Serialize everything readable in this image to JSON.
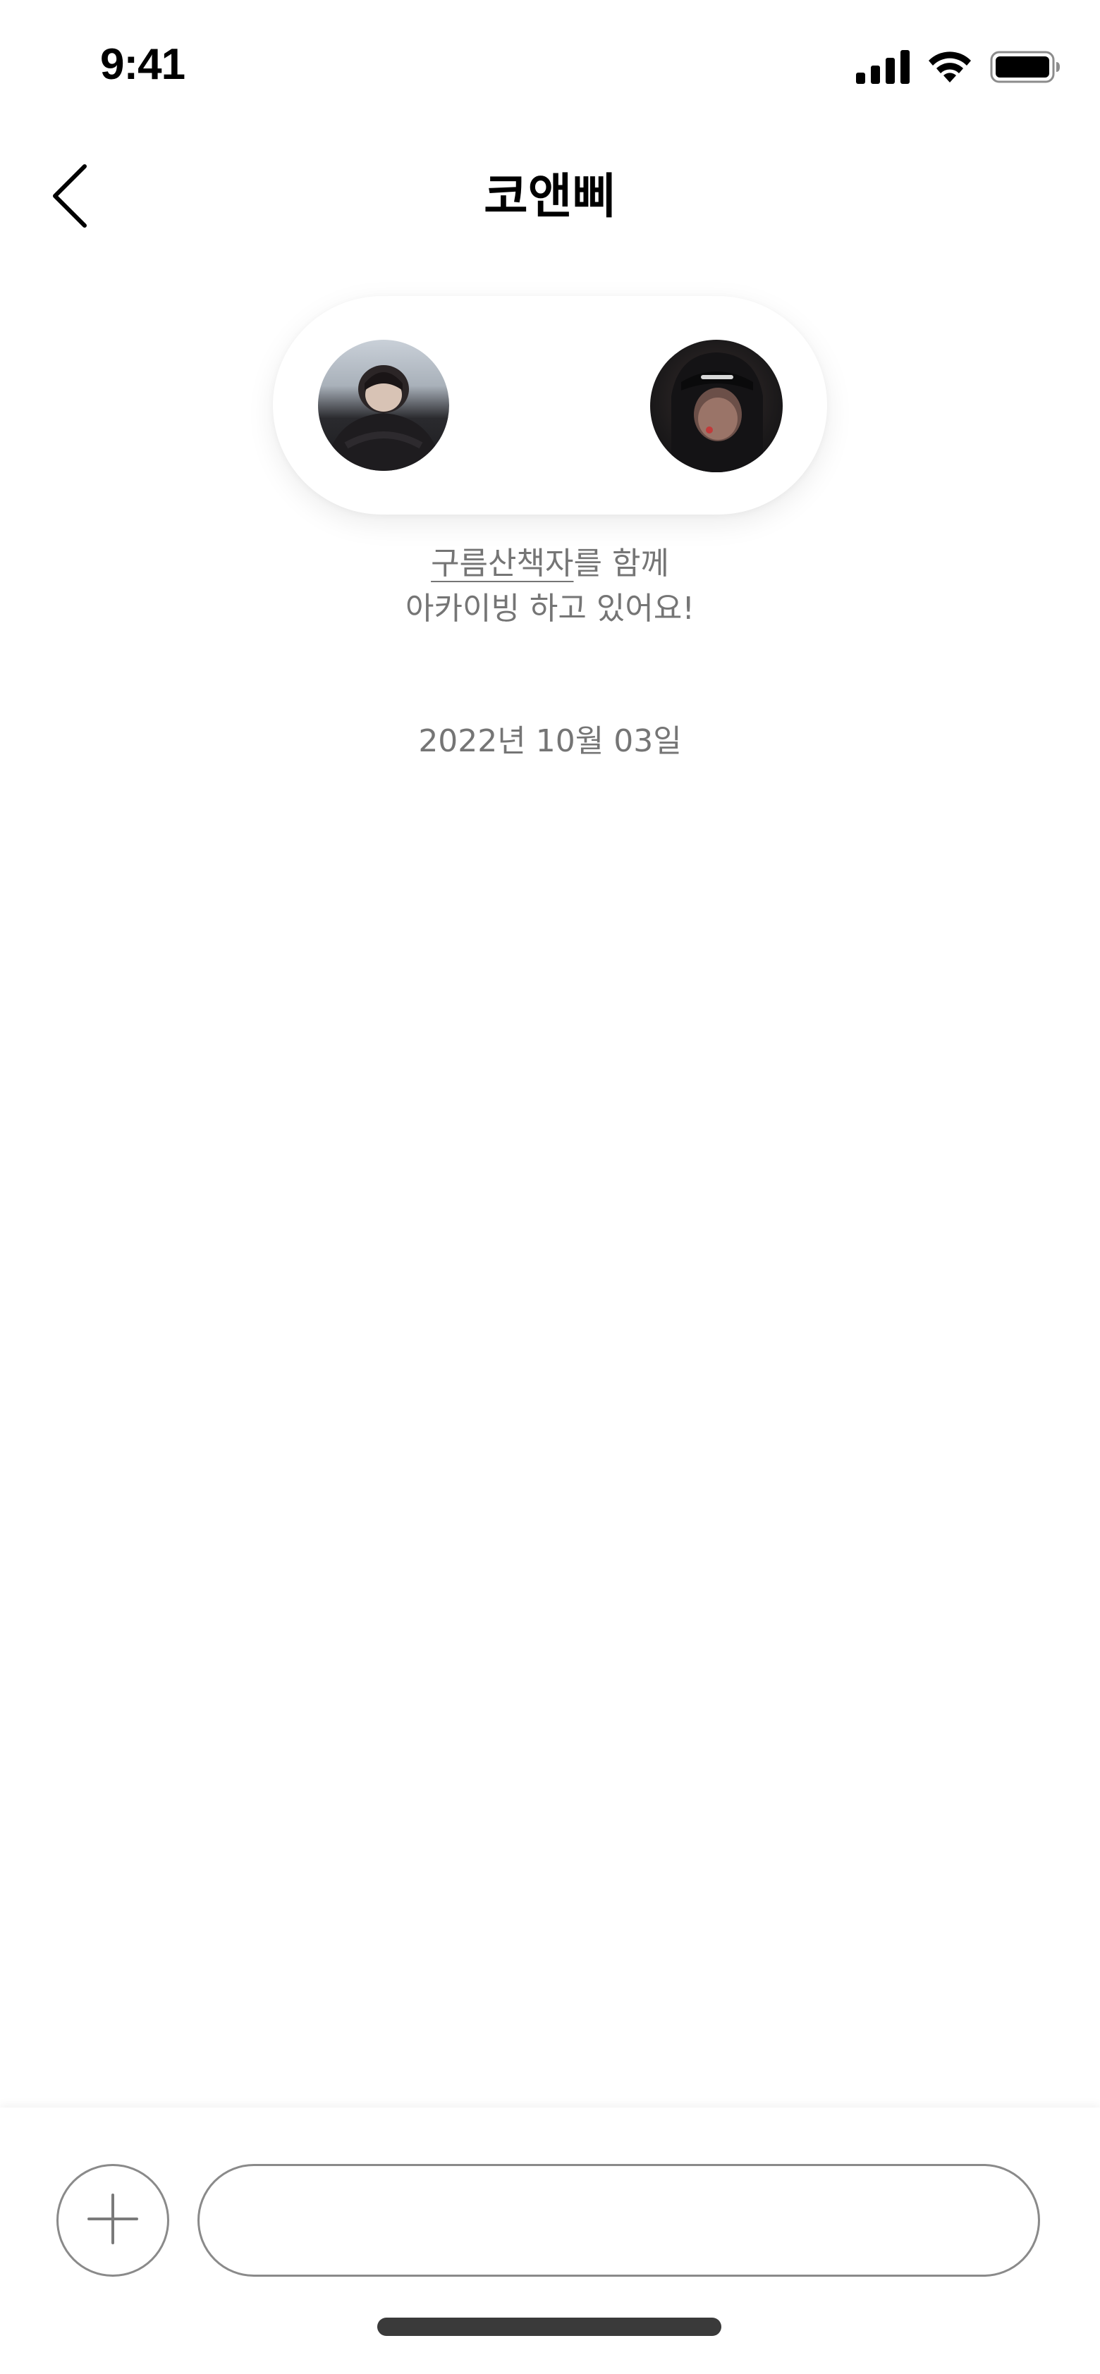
{
  "status_bar": {
    "time": "9:41",
    "icons": [
      "cellular-signal-icon",
      "wifi-icon",
      "battery-icon"
    ]
  },
  "nav": {
    "title": "코앤삐",
    "back_icon": "chevron-left-icon"
  },
  "participants": {
    "avatars": [
      "avatar-user-left",
      "avatar-user-right"
    ]
  },
  "archive_message": {
    "walker_name": "구름산책자",
    "line1_suffix": "를 함께",
    "line2": "아카이빙 하고 있어요!"
  },
  "date": "2022년 10월 03일",
  "composer": {
    "add_icon": "plus-icon",
    "input_value": "",
    "input_placeholder": ""
  },
  "colors": {
    "muted_text": "#757575",
    "border": "#8a8a8a",
    "home_indicator": "#3a3a3a"
  }
}
